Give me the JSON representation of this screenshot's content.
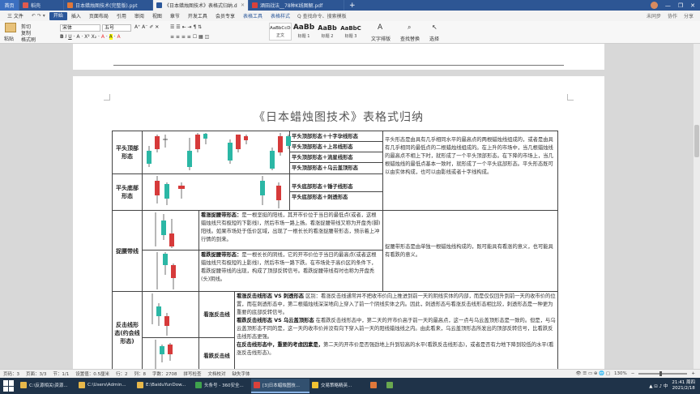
{
  "tabs": {
    "home": "首页",
    "items": [
      {
        "label": "稻壳",
        "color": "#e15a4e",
        "active": false
      },
      {
        "label": "日本蜡烛图技术(完整版).ppt",
        "color": "#e0783a",
        "active": false
      },
      {
        "label": "《日本蜡烛图技术》表格式归纳.doc",
        "color": "#2b579a",
        "active": true
      },
      {
        "label": "酒田战法__78种K线图解.pdf",
        "color": "#d9413b",
        "active": false
      }
    ],
    "add": "+",
    "window_controls": [
      "—",
      "❐",
      "✕"
    ]
  },
  "menu": {
    "file": "三 文件",
    "items": [
      "开始",
      "插入",
      "页面布局",
      "引用",
      "审阅",
      "视图",
      "章节",
      "开发工具",
      "会员专享"
    ],
    "tools": [
      "表格工具",
      "表格样式"
    ],
    "search": "Q 查找命令、搜索模板",
    "right": [
      "未同步",
      "协作",
      "分享"
    ]
  },
  "ribbon": {
    "paste": "粘贴",
    "cut": "剪切",
    "copy": "复制",
    "format_painter": "格式刷",
    "font_name": "宋体",
    "font_size": "五号",
    "styles": [
      {
        "preview": "AaBbCcDd",
        "name": "正文"
      },
      {
        "preview": "AaBb",
        "name": "标题 1"
      },
      {
        "preview": "AaBb",
        "name": "标题 2"
      },
      {
        "preview": "AaBbC",
        "name": "标题 3"
      }
    ],
    "text_tools": "文字排版",
    "find_replace": "查找替换",
    "select": "选择"
  },
  "doc": {
    "title": "《日本蜡烛图技术》表格式归纳",
    "rows": {
      "pingtou_top": {
        "name": "平头顶部形态",
        "types": [
          "平头顶部形态＋十字孕线形态",
          "平头顶部形态＋上吊线形态",
          "平头顶部形态＋流星线形态",
          "平头顶部形态＋乌云盖顶形态"
        ]
      },
      "pingtou_bottom": {
        "name": "平头底部形态",
        "types": [
          "平头底部形态＋锤子线形态",
          "平头底部形态＋刺透形态"
        ]
      },
      "pingtou_desc": "平头形态是由具有几乎相同水平的最高点的两根蜡烛线组成的，或者是由具有几乎相同的最低点的二根蜡烛线组成的。在上升的市场中，当几根蜡烛线的最高点不相上下时，就形成了一个平头顶部形态。在下降的市场上，当几根蜡烛线的最低点基本一致时，就形成了一个平头底部形态。平头形态既可以由实体构成，也可以由影线或者十字线构成。",
      "zhuoyao": {
        "name": "捉腰带线",
        "bull_title": "看涨捉腰带形态：",
        "bull_text": "是一根坚挺的阳线，其开市价位于当日的最低点(或者，这根蜡烛线只有极短的下影线)，然后市场一路上扬。看涨捉腰带线又称为开盘秃(脚)阳线。如果市场处于低价区域，出现了一根长长的看涨捉腰带形态，预示着上冲行情的到来。",
        "bear_title": "看跌捉腰带形态：",
        "bear_text": "是一根长长的阴线，它的开市价位于当日的最高点(或者这根蜡烛线只有极短的上影线)，然后市场一路下跌。在市场处于高价区的条件下，看跌捉腰带线的出现，构成了顶部反转信号。看跌捉腰带线有时也称为开盘秃(头)阴线。",
        "desc": "捉腰带形态是由单独一根蜡烛线构成的，既可能具有看涨的意义，也可能具有看跌的意义。"
      },
      "fanji": {
        "name": "反击线形态(约会线形态)",
        "bull_name": "看涨反击线",
        "bear_name": "看跌反击线",
        "p1_title": "看涨反击线形态 VS 刺透形态",
        "p1_text": " 区别：看涨反击线通常并不把收市价向上推进到前一天的阴线实体的内部，而是仅仅回升到前一天的收市价的位置，而在刺透形态中，第二根蜡烛线深深地向上穿入了前一个阴线实体之内。因此，刺透形态与看涨反击线形态相比较，刺透形态是一种更为重要的底部反转信号。",
        "p2_title": "看跌反击线形态 VS 乌云盖顶形态",
        "p2_text": " 在看跌反击线形态中，第二天的开市价高于前一天的最高点，这一点与乌云盖顶形态是一致的。但是，与乌云盖顶形态不同的是，这一天的收市价并没有向下穿入前一天的阳线蜡烛线之内。由此看来，乌云盖顶形态所发出的顶部反转信号，比看跌反击线形态更强。",
        "p3_title": "在反击线形态中，重要的考虑因素是，",
        "p3_text": "第二天的开市价是否强劲地上升到较高的水平(看跌反击线形态)，或者是否有力地下降到较低的水平(看涨反击线形态)。"
      }
    }
  },
  "status": {
    "page": "页码：3",
    "pages": "页面：3/3",
    "section": "节：1/1",
    "settings": "设置值：0.5厘米",
    "row": "行：2",
    "col": "列：8",
    "words": "字数：2708",
    "spell": "拼写检查",
    "doc_check": "文档校对",
    "missing_font": "缺失字体",
    "zoom": "130%"
  },
  "taskbar": {
    "items": [
      {
        "label": "C:\\反源相关\\资源...",
        "color": "#e8b84a",
        "active": false
      },
      {
        "label": "C:\\Users\\Admin...",
        "color": "#e8b84a",
        "active": false
      },
      {
        "label": "E:\\BaiduYunDow...",
        "color": "#e8b84a",
        "active": false
      },
      {
        "label": "头条号 - 360安全...",
        "color": "#3fa34d",
        "active": false
      },
      {
        "label": "[3]日本蜡烛图技...",
        "color": "#d9413b",
        "active": true
      },
      {
        "label": "交易策略精英...",
        "color": "#f1c232",
        "active": false
      },
      {
        "label": "",
        "color": "#e0783a",
        "active": false
      },
      {
        "label": "",
        "color": "#6aa84f",
        "active": false
      }
    ],
    "time": "21:41 周四",
    "date": "2021/2/18"
  },
  "colors": {
    "bull": "#2bb7a5",
    "bear": "#d63a3a",
    "accent": "#2b579a"
  }
}
